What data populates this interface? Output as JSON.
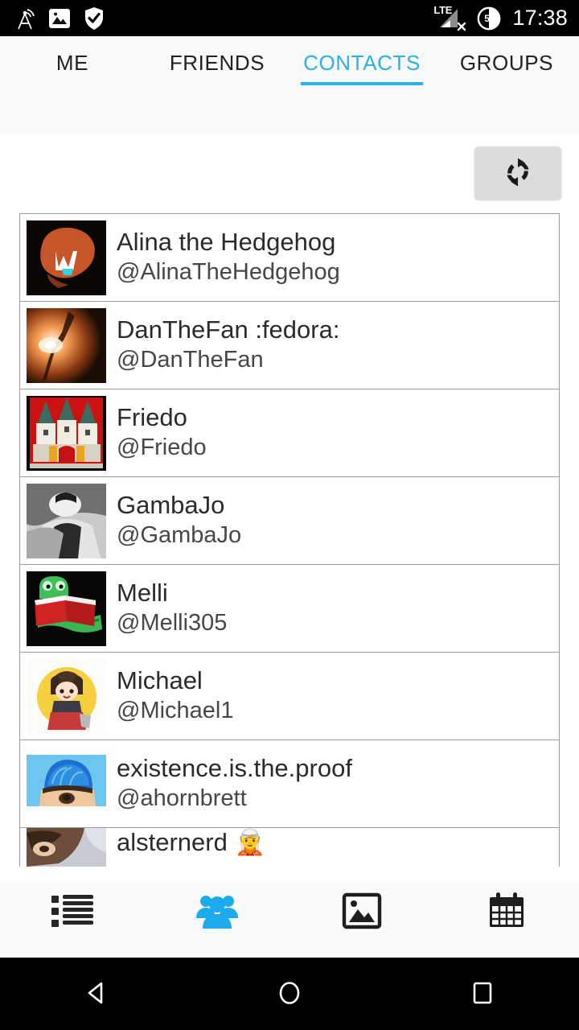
{
  "statusbar": {
    "icons": [
      "cast-screen-icon",
      "image-icon",
      "shield-check-icon"
    ],
    "network_label": "LTE",
    "network_state": "no-service",
    "battery_percent": "50",
    "time": "17:38"
  },
  "tabs": [
    {
      "label": "ME",
      "active": false
    },
    {
      "label": "FRIENDS",
      "active": false
    },
    {
      "label": "CONTACTS",
      "active": true
    },
    {
      "label": "GROUPS",
      "active": false
    }
  ],
  "toolbar": {
    "refresh_label": "refresh-icon"
  },
  "contacts": [
    {
      "name": "Alina the Hedgehog",
      "handle": "@AlinaTheHedgehog",
      "avatar": "orange-blob-dark"
    },
    {
      "name": "DanTheFan :fedora:",
      "handle": "@DanTheFan",
      "avatar": "concert-fire-photo"
    },
    {
      "name": "Friedo",
      "handle": "@Friedo",
      "avatar": "city-crest-red"
    },
    {
      "name": "GambaJo",
      "handle": "@GambaJo",
      "avatar": "bw-portrait-photo"
    },
    {
      "name": "Melli",
      "handle": "@Melli305",
      "avatar": "green-bookworm"
    },
    {
      "name": "Michael",
      "handle": "@Michael1",
      "avatar": "anime-chibi-yellow"
    },
    {
      "name": "existence.is.the.proof",
      "handle": "@ahornbrett",
      "avatar": "blue-beanie-photo"
    },
    {
      "name": "alsternerd 🧝",
      "handle": "",
      "avatar": "face-closeup-photo",
      "partial": true
    }
  ],
  "bottomnav": [
    {
      "icon": "list-icon",
      "active": false
    },
    {
      "icon": "people-group-icon",
      "active": true
    },
    {
      "icon": "image-icon",
      "active": false
    },
    {
      "icon": "calendar-icon",
      "active": false
    }
  ],
  "androidnav": [
    {
      "icon": "back-triangle-icon"
    },
    {
      "icon": "home-circle-icon"
    },
    {
      "icon": "recents-square-icon"
    }
  ],
  "colors": {
    "accent": "#29b0ef",
    "statusbar_bg": "#000000",
    "chrome_bg": "#fafafa",
    "list_border": "#9b9b9b",
    "name_text": "#2b2b2b",
    "handle_text": "#474747"
  }
}
